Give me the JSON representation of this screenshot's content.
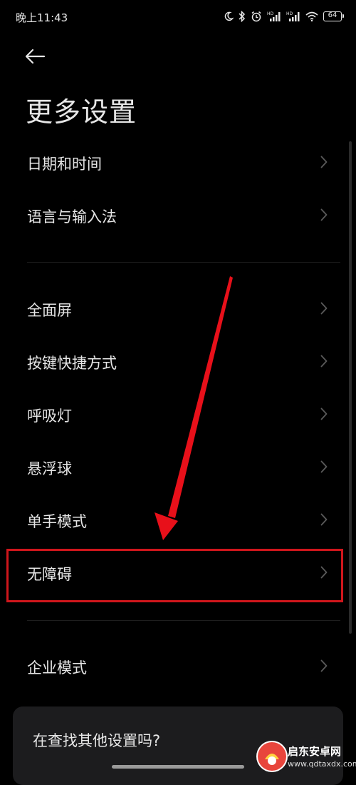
{
  "status_bar": {
    "time": "晚上11:43",
    "battery_level": "64",
    "icons": [
      "moon-icon",
      "bluetooth-icon",
      "alarm-icon",
      "signal-hd-1-icon",
      "signal-hd-2-icon",
      "wifi-icon",
      "battery-icon"
    ]
  },
  "header": {
    "back_icon": "back-arrow-icon",
    "title": "更多设置"
  },
  "section1": [
    {
      "label": "日期和时间"
    },
    {
      "label": "语言与输入法"
    }
  ],
  "section2": [
    {
      "label": "全面屏"
    },
    {
      "label": "按键快捷方式"
    },
    {
      "label": "呼吸灯"
    },
    {
      "label": "悬浮球"
    },
    {
      "label": "单手模式"
    },
    {
      "label": "无障碍"
    }
  ],
  "section3": [
    {
      "label": "企业模式"
    }
  ],
  "suggestion": {
    "text": "在查找其他设置吗?"
  },
  "annotation": {
    "highlighted_item": "无障碍",
    "highlight_color": "#d0161c",
    "arrow_color": "#e8101a"
  },
  "watermark": {
    "title": "启东安卓网",
    "url": "www.qdtaxdx.com",
    "logo_color": "#e8453c"
  },
  "colors": {
    "background": "#000000",
    "text": "#e6e6e6",
    "chevron": "#5a5a5a",
    "card": "#1c1c1e"
  }
}
